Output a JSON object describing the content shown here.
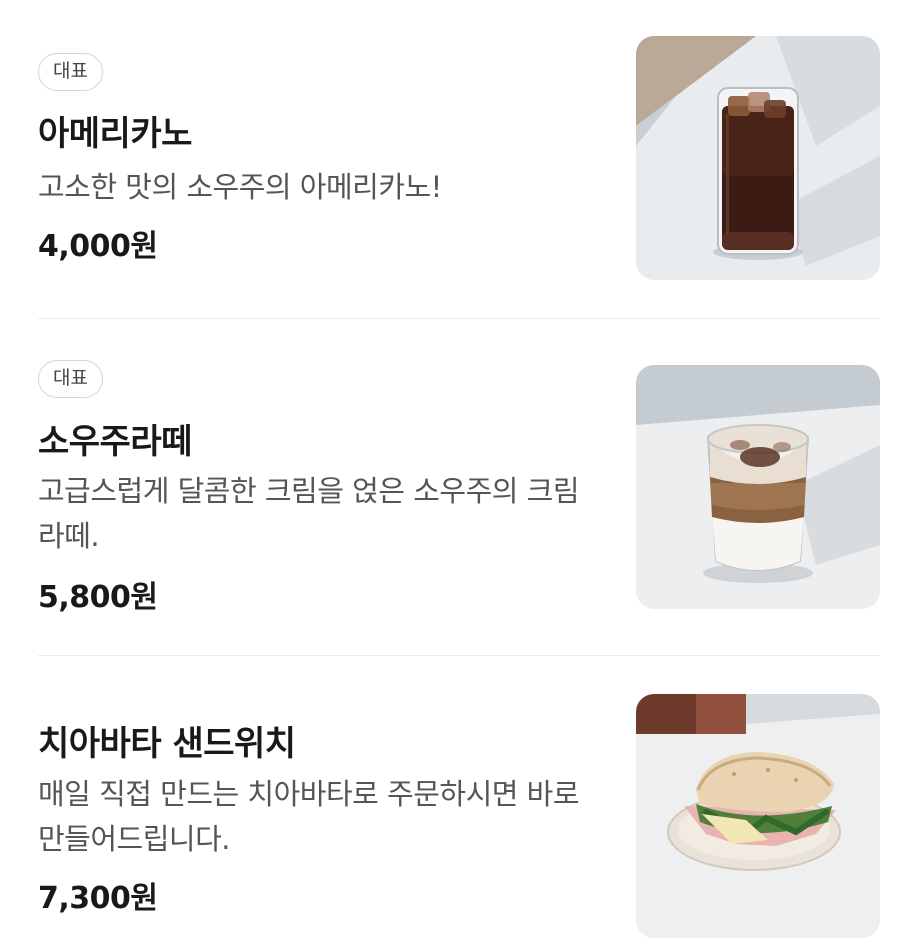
{
  "menu": [
    {
      "badge": "대표",
      "name": "아메리카노",
      "description": "고소한 맛의 소우주의 아메리카노!",
      "price": "4,000원",
      "image_icon": "iced-americano-photo"
    },
    {
      "badge": "대표",
      "name": "소우주라떼",
      "description": "고급스럽게 달콤한 크림을 얹은 소우주의 크림라떼.",
      "price": "5,800원",
      "image_icon": "cream-latte-photo"
    },
    {
      "name": "치아바타 샌드위치",
      "description": "매일 직접 만드는 치아바타로 주문하시면 바로 만들어드립니다.",
      "price": "7,300원",
      "image_icon": "ciabatta-sandwich-photo"
    }
  ]
}
